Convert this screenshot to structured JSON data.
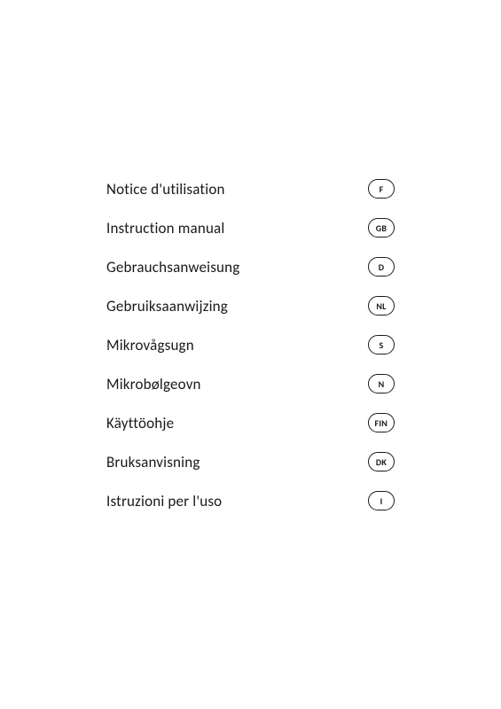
{
  "page": {
    "background": "#ffffff",
    "items": [
      {
        "label": "Notice d'utilisation",
        "badge": "F"
      },
      {
        "label": "Instruction manual",
        "badge": "GB"
      },
      {
        "label": "Gebrauchsanweisung",
        "badge": "D"
      },
      {
        "label": "Gebruiksaanwijzing",
        "badge": "NL"
      },
      {
        "label": "Mikrovågsugn",
        "badge": "S"
      },
      {
        "label": "Mikrobølgeovn",
        "badge": "N"
      },
      {
        "label": "Käyttöohje",
        "badge": "FIN"
      },
      {
        "label": "Bruksanvisning",
        "badge": "DK"
      },
      {
        "label": "Istruzioni per l'uso",
        "badge": "I"
      }
    ]
  }
}
